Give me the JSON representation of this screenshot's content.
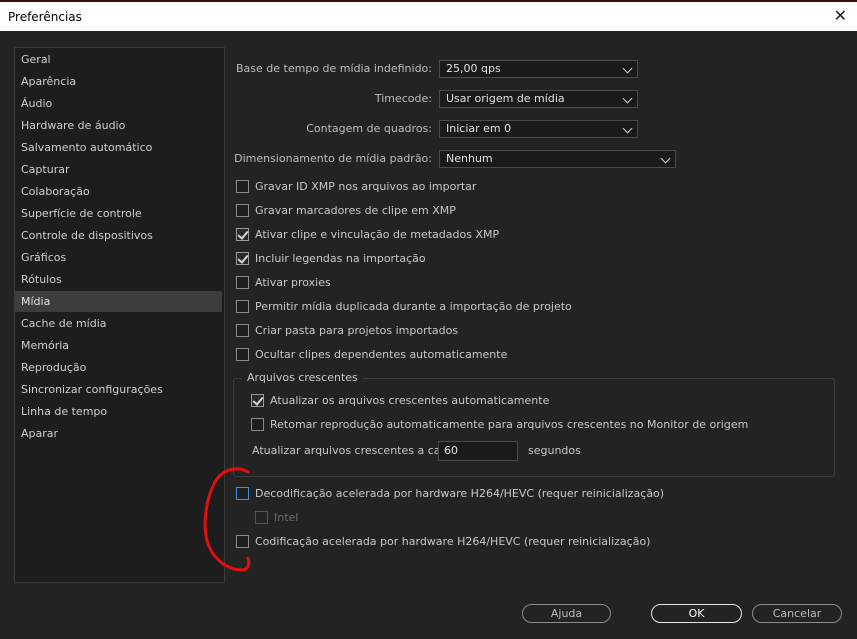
{
  "window": {
    "title": "Preferências",
    "close_glyph": "✕"
  },
  "sidebar": {
    "items": [
      {
        "label": "Geral"
      },
      {
        "label": "Aparência"
      },
      {
        "label": "Áudio"
      },
      {
        "label": "Hardware de áudio"
      },
      {
        "label": "Salvamento automático"
      },
      {
        "label": "Capturar"
      },
      {
        "label": "Colaboração"
      },
      {
        "label": "Superfície de controle"
      },
      {
        "label": "Controle de dispositivos"
      },
      {
        "label": "Gráficos"
      },
      {
        "label": "Rótulos"
      },
      {
        "label": "Mídia",
        "selected": true
      },
      {
        "label": "Cache de mídia"
      },
      {
        "label": "Memória"
      },
      {
        "label": "Reprodução"
      },
      {
        "label": "Sincronizar configurações"
      },
      {
        "label": "Linha de tempo"
      },
      {
        "label": "Aparar"
      }
    ]
  },
  "settings": {
    "timebase": {
      "label": "Base de tempo de mídia indefinido:",
      "value": "25,00  qps"
    },
    "timecode": {
      "label": "Timecode:",
      "value": "Usar origem de mídia"
    },
    "frame_count": {
      "label": "Contagem de quadros:",
      "value": "Iniciar em 0"
    },
    "scaling": {
      "label": "Dimensionamento de mídia padrão:",
      "value": "Nenhum"
    }
  },
  "checkboxes": [
    {
      "label": "Gravar ID XMP nos arquivos ao importar",
      "checked": false
    },
    {
      "label": "Gravar marcadores de clipe em XMP",
      "checked": false
    },
    {
      "label": "Ativar clipe e vinculação de metadados XMP",
      "checked": true
    },
    {
      "label": "Incluir legendas na importação",
      "checked": true
    },
    {
      "label": "Ativar proxies",
      "checked": false
    },
    {
      "label": "Permitir mídia duplicada durante a importação de projeto",
      "checked": false
    },
    {
      "label": "Criar pasta para projetos importados",
      "checked": false
    },
    {
      "label": "Ocultar clipes dependentes automaticamente",
      "checked": false
    }
  ],
  "growing_files": {
    "legend": "Arquivos crescentes",
    "auto_refresh": {
      "label": "Atualizar os arquivos crescentes automaticamente",
      "checked": true
    },
    "resume_playback": {
      "label": "Retomar reprodução automaticamente para arquivos crescentes no Monitor de origem",
      "checked": false
    },
    "interval_label": "Atualizar arquivos crescentes a cada",
    "interval_value": "60",
    "interval_unit": "segundos"
  },
  "hardware": {
    "decode": {
      "label": "Decodificação acelerada por hardware H264/HEVC (requer reinicialização)",
      "checked": false
    },
    "intel": {
      "label": "Intel",
      "checked": false
    },
    "encode": {
      "label": "Codificação acelerada por hardware H264/HEVC (requer reinicialização)",
      "checked": false
    }
  },
  "buttons": {
    "help": "Ajuda",
    "ok": "OK",
    "cancel": "Cancelar"
  },
  "colors": {
    "annotation": "#e01010",
    "focus": "#3f8fe0",
    "background": "#232323"
  }
}
